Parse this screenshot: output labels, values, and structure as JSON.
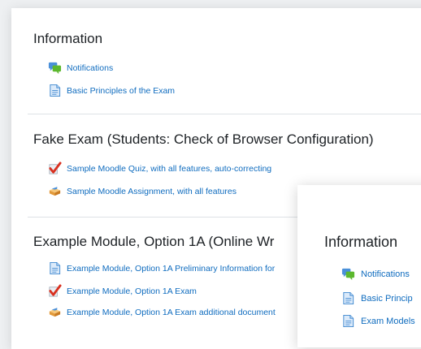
{
  "main": {
    "sections": [
      {
        "title": "Information",
        "items": [
          {
            "label": "Notifications",
            "icon": "forum-icon"
          },
          {
            "label": "Basic Principles of the Exam",
            "icon": "page-icon"
          }
        ]
      },
      {
        "title": "Fake Exam (Students: Check of Browser Configuration)",
        "items": [
          {
            "label": "Sample Moodle Quiz, with all features, auto-correcting",
            "icon": "quiz-icon"
          },
          {
            "label": "Sample Moodle Assignment, with all features",
            "icon": "assignment-icon"
          }
        ]
      },
      {
        "title": "Example Module, Option 1A (Online Wr",
        "items": [
          {
            "label": "Example Module, Option 1A Preliminary Information for",
            "icon": "page-icon"
          },
          {
            "label": "Example Module, Option 1A Exam",
            "icon": "quiz-icon"
          },
          {
            "label": "Example Module, Option 1A Exam additional document",
            "icon": "assignment-icon"
          }
        ]
      }
    ]
  },
  "overlay": {
    "title": "Information",
    "items": [
      {
        "label": "Notifications",
        "icon": "forum-icon"
      },
      {
        "label": "Basic Princip",
        "icon": "page-icon"
      },
      {
        "label": "Exam Models",
        "icon": "page-icon"
      }
    ]
  },
  "colors": {
    "link": "#0f6cbf",
    "text": "#1d2125",
    "divider": "#dee2e6"
  }
}
